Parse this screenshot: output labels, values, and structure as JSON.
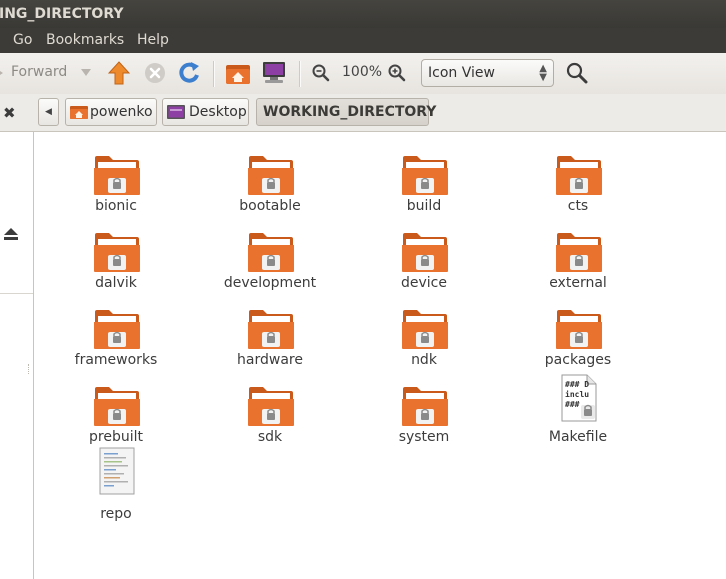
{
  "window": {
    "title": "ING_DIRECTORY"
  },
  "menu": {
    "items": [
      "Go",
      "Bookmarks",
      "Help"
    ]
  },
  "toolbar": {
    "forward_label": "Forward",
    "zoom_level": "100%",
    "view_mode": "Icon View",
    "icons": [
      "back-arrow-icon",
      "forward-arrow-icon",
      "dropdown-arrow-icon",
      "up-arrow-icon",
      "stop-icon",
      "reload-icon",
      "home-folder-icon",
      "computer-icon",
      "zoom-out-icon",
      "zoom-in-icon",
      "search-icon"
    ]
  },
  "location": {
    "crumbs": [
      {
        "label": "powenko",
        "icon": "home-folder-icon"
      },
      {
        "label": "Desktop",
        "icon": "desktop-icon"
      },
      {
        "label": "WORKING_DIRECTORY",
        "icon": ""
      }
    ]
  },
  "files": [
    {
      "name": "bionic",
      "type": "folder"
    },
    {
      "name": "bootable",
      "type": "folder"
    },
    {
      "name": "build",
      "type": "folder"
    },
    {
      "name": "cts",
      "type": "folder"
    },
    {
      "name": "dalvik",
      "type": "folder"
    },
    {
      "name": "development",
      "type": "folder"
    },
    {
      "name": "device",
      "type": "folder"
    },
    {
      "name": "external",
      "type": "folder"
    },
    {
      "name": "frameworks",
      "type": "folder"
    },
    {
      "name": "hardware",
      "type": "folder"
    },
    {
      "name": "ndk",
      "type": "folder"
    },
    {
      "name": "packages",
      "type": "folder"
    },
    {
      "name": "prebuilt",
      "type": "folder"
    },
    {
      "name": "sdk",
      "type": "folder"
    },
    {
      "name": "system",
      "type": "folder"
    },
    {
      "name": "Makefile",
      "type": "makefile",
      "preview": [
        "### D",
        "inclu",
        "###"
      ]
    },
    {
      "name": "repo",
      "type": "script"
    }
  ],
  "colors": {
    "folder_body": "#e9722e",
    "folder_back": "#c95a1c",
    "folder_paper": "#ffffff",
    "lock_gray": "#8a8a8a"
  }
}
